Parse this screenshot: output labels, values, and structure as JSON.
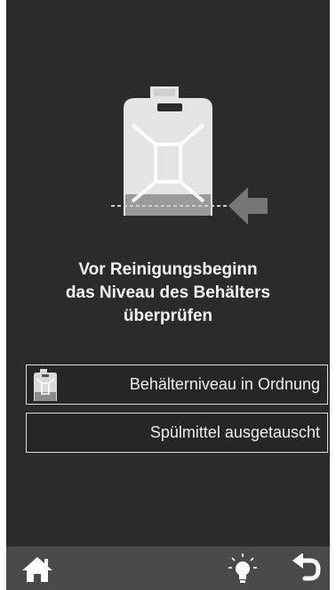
{
  "message": {
    "line1": "Vor Reinigungsbeginn",
    "line2": "das Niveau des Behälters",
    "line3": "überprüfen"
  },
  "options": [
    {
      "label": "Behälterniveau in Ordnung",
      "icon": "canister-icon"
    },
    {
      "label": "Spülmittel ausgetauscht"
    }
  ],
  "bottom_bar": {
    "icons": [
      "home-icon",
      "lightbulb-icon",
      "back-arrow-icon"
    ]
  },
  "colors": {
    "screen_background": "#2b2b2b",
    "bottom_bar": "#4a4a4a",
    "text": "#f2f2f2",
    "canister": "#e6e6e6",
    "arrow": "#777777"
  }
}
